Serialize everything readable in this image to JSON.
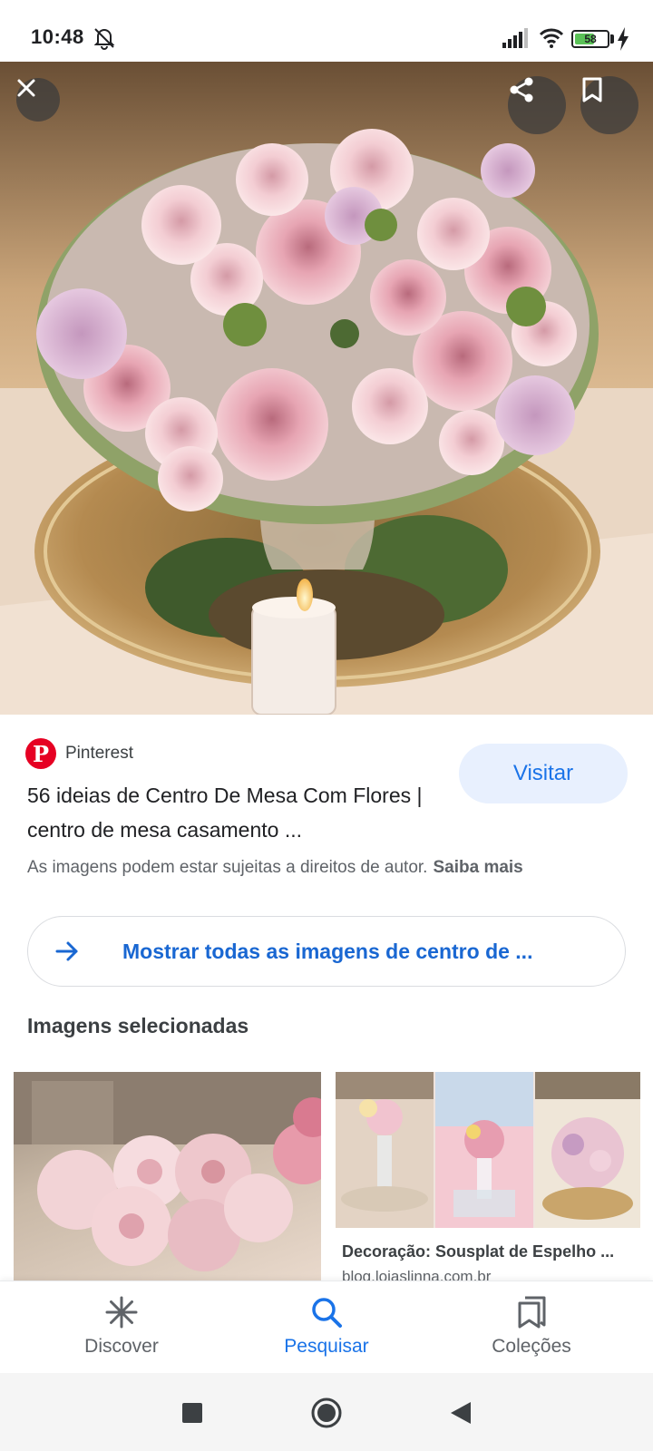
{
  "status_bar": {
    "time": "10:48",
    "battery_level": "58",
    "icons": [
      "bell-off-icon",
      "signal-icon",
      "wifi-icon",
      "battery-icon",
      "charging-icon"
    ]
  },
  "hero": {
    "alt": "Centro de mesa com rosas cor-de-rosa e vela",
    "buttons": [
      "close-icon",
      "share-icon",
      "bookmark-icon"
    ]
  },
  "result": {
    "source": "Pinterest",
    "visit_label": "Visitar",
    "title": "56 ideias de Centro De Mesa Com Flores | centro de mesa casamento ...",
    "rights_text": "As imagens podem estar sujeitas a direitos de autor.",
    "learn_more": "Saiba mais"
  },
  "show_all": {
    "label": "Mostrar todas as imagens de centro de ..."
  },
  "related": {
    "section_title": "Imagens selecionadas",
    "items": [
      {
        "caption": "",
        "domain": ""
      },
      {
        "caption": "Decoração: Sousplat de Espelho ...",
        "domain": "blog.lojaslinna.com.br"
      }
    ]
  },
  "bottom_nav": {
    "items": [
      {
        "label": "Discover",
        "icon": "asterisk-icon",
        "active": false
      },
      {
        "label": "Pesquisar",
        "icon": "search-icon",
        "active": true
      },
      {
        "label": "Coleções",
        "icon": "collections-icon",
        "active": false
      }
    ]
  },
  "colors": {
    "accent": "#1a73e8",
    "pinterest": "#e60023",
    "visit_bg": "#e8f0fe"
  }
}
